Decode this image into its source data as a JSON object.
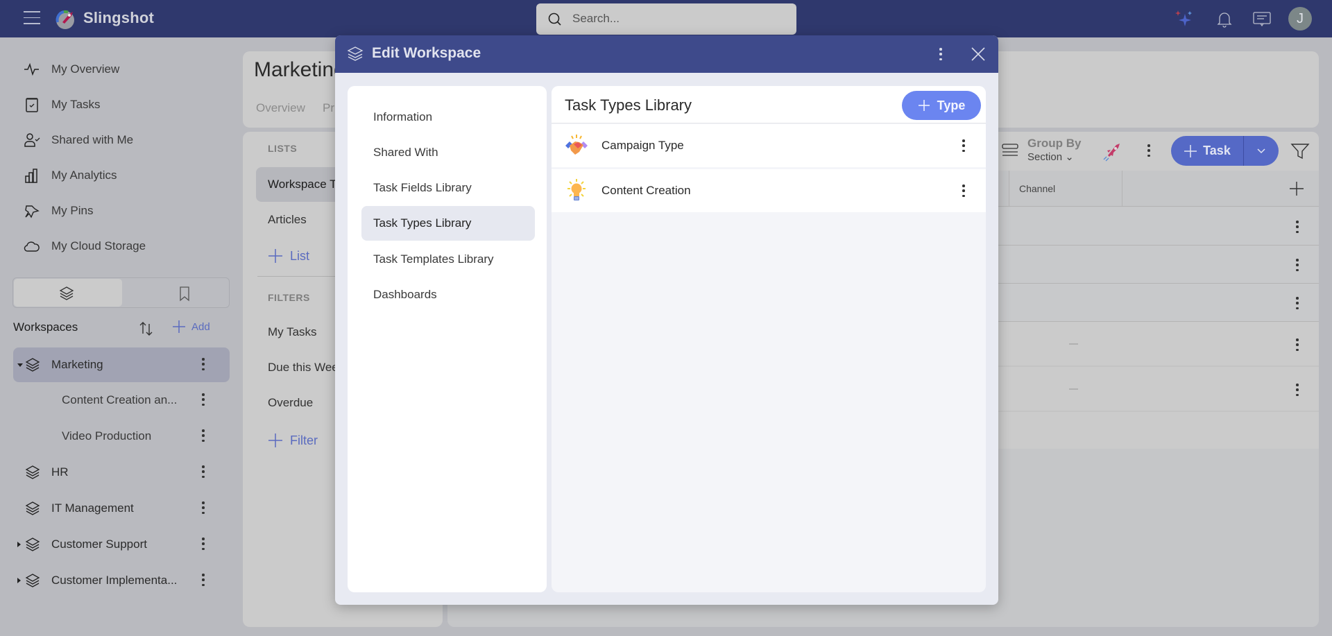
{
  "app": {
    "brand": "Slingshot",
    "search_placeholder": "Search...",
    "avatar_initial": "J"
  },
  "sidebar": {
    "nav": [
      {
        "label": "My Overview",
        "icon": "activity-icon"
      },
      {
        "label": "My Tasks",
        "icon": "clipboard-check-icon"
      },
      {
        "label": "Shared with Me",
        "icon": "user-check-icon"
      },
      {
        "label": "My Analytics",
        "icon": "bar-chart-icon"
      },
      {
        "label": "My Pins",
        "icon": "pin-icon"
      },
      {
        "label": "My Cloud Storage",
        "icon": "cloud-icon"
      }
    ],
    "workspaces_title": "Workspaces",
    "add_label": "Add",
    "workspaces": [
      {
        "label": "Marketing",
        "expanded": true,
        "selected": true
      },
      {
        "label": "Content Creation an...",
        "child": true
      },
      {
        "label": "Video Production",
        "child": true
      },
      {
        "label": "HR"
      },
      {
        "label": "IT Management"
      },
      {
        "label": "Customer Support",
        "expandable": true
      },
      {
        "label": "Customer Implementa...",
        "expandable": true
      }
    ]
  },
  "workspace": {
    "title": "Marketing",
    "tabs": [
      "Overview",
      "Pr"
    ],
    "lists_label": "LISTS",
    "lists": [
      "Workspace T",
      "Articles"
    ],
    "add_list_label": "List",
    "filters_label": "FILTERS",
    "filters": [
      "My Tasks",
      "Due this Wee",
      "Overdue"
    ],
    "add_filter_label": "Filter",
    "toolbar": {
      "group_by_label": "Group By",
      "group_by_value": "Section",
      "task_button_label": "Task"
    },
    "grid": {
      "columns": [
        "Channel"
      ],
      "row_dash": "—"
    }
  },
  "modal": {
    "title": "Edit Workspace",
    "nav": [
      {
        "label": "Information"
      },
      {
        "label": "Shared With"
      },
      {
        "label": "Task Fields Library"
      },
      {
        "label": "Task Types Library",
        "selected": true
      },
      {
        "label": "Task Templates Library"
      },
      {
        "label": "Dashboards"
      }
    ],
    "content": {
      "title": "Task Types Library",
      "add_button_label": "Type",
      "items": [
        {
          "label": "Campaign Type",
          "icon": "handshake-icon"
        },
        {
          "label": "Content Creation",
          "icon": "lightbulb-icon"
        }
      ]
    }
  }
}
